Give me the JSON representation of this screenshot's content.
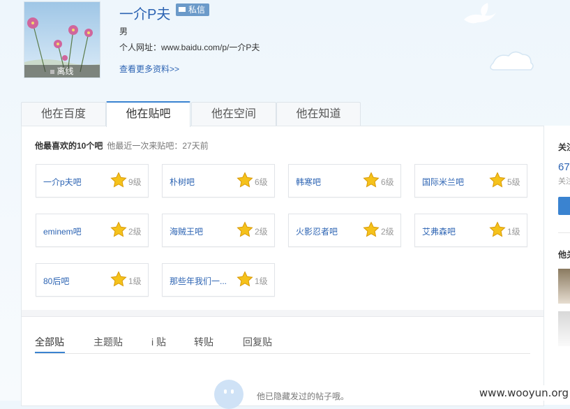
{
  "profile": {
    "username": "一介P夫",
    "message_label": "私信",
    "gender": "男",
    "homepage": "个人网址：www.baidu.com/p/一介P夫",
    "more_link": "查看更多资料>>",
    "status": "离线"
  },
  "tabs": [
    {
      "label": "他在百度",
      "active": false
    },
    {
      "label": "他在贴吧",
      "active": true
    },
    {
      "label": "他在空间",
      "active": false
    },
    {
      "label": "他在知道",
      "active": false
    }
  ],
  "favorites": {
    "title": "他最喜欢的10个吧",
    "last_visit": "他最近一次来贴吧：27天前",
    "bars": [
      {
        "name": "一介p夫吧",
        "level": "9级"
      },
      {
        "name": "朴树吧",
        "level": "6级"
      },
      {
        "name": "韩寒吧",
        "level": "6级"
      },
      {
        "name": "国际米兰吧",
        "level": "5级"
      },
      {
        "name": "eminem吧",
        "level": "2级"
      },
      {
        "name": "海贼王吧",
        "level": "2级"
      },
      {
        "name": "火影忍者吧",
        "level": "2级"
      },
      {
        "name": "艾弗森吧",
        "level": "1级"
      },
      {
        "name": "80后吧",
        "level": "1级"
      },
      {
        "name": "那些年我们一...",
        "level": "1级"
      }
    ]
  },
  "feed_tabs": [
    {
      "label": "全部贴",
      "active": true
    },
    {
      "label": "主题贴",
      "active": false
    },
    {
      "label": "i 贴",
      "active": false
    },
    {
      "label": "转贴",
      "active": false
    },
    {
      "label": "回复贴",
      "active": false
    }
  ],
  "empty_hint": "他已隐藏发过的帖子哦。",
  "sidebar": {
    "heading1": "关注",
    "count": "67",
    "count_label": "关注",
    "heading2": "他关"
  },
  "watermark": "www.wooyun.org",
  "colors": {
    "link": "#2d64b3",
    "accent": "#3a83d0",
    "star": "#f3b20f"
  }
}
